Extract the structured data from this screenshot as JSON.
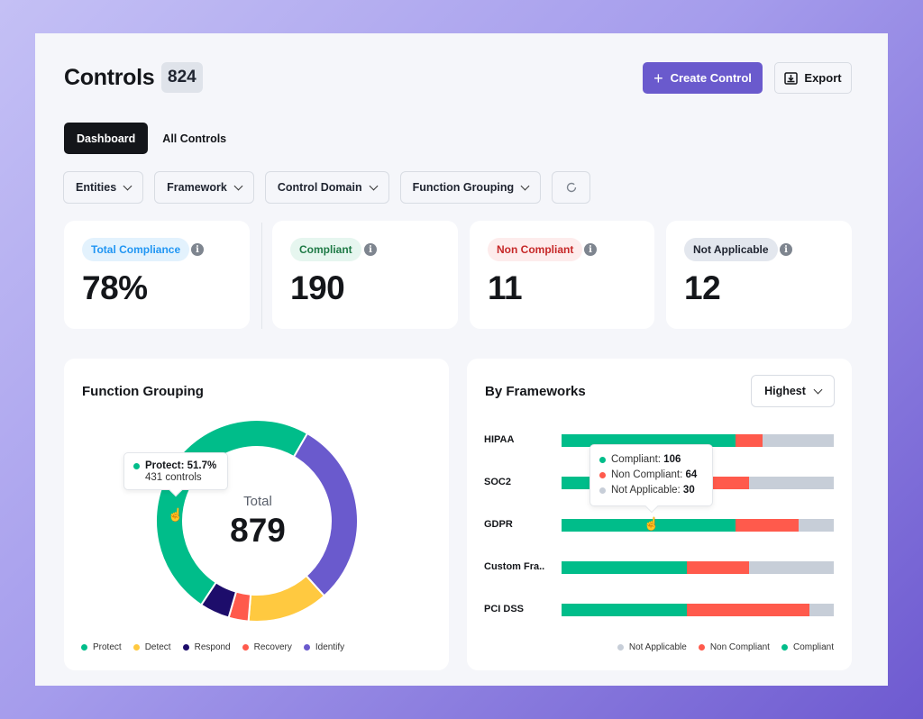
{
  "header": {
    "title": "Controls",
    "count": "824",
    "create_label": "Create Control",
    "export_label": "Export"
  },
  "tabs": [
    {
      "label": "Dashboard",
      "active": true
    },
    {
      "label": "All Controls",
      "active": false
    }
  ],
  "filters": [
    {
      "label": "Entities"
    },
    {
      "label": "Framework"
    },
    {
      "label": "Control Domain"
    },
    {
      "label": "Function Grouping"
    }
  ],
  "refresh_icon": "refresh-icon",
  "stats": [
    {
      "label": "Total Compliance",
      "value": "78%",
      "pill_bg": "#e3f2fd",
      "pill_fg": "#2196f3"
    },
    {
      "label": "Compliant",
      "value": "190",
      "pill_bg": "#e6f6ef",
      "pill_fg": "#1f7a46"
    },
    {
      "label": "Non Compliant",
      "value": "11",
      "pill_bg": "#fdecec",
      "pill_fg": "#c62828"
    },
    {
      "label": "Not Applicable",
      "value": "12",
      "pill_bg": "#e3e7ee",
      "pill_fg": "#1f2430"
    }
  ],
  "function_grouping": {
    "title": "Function Grouping",
    "center_label": "Total",
    "center_value": "879",
    "tooltip": {
      "title": "Protect: 51.7%",
      "sub": "431 controls",
      "color": "#00bd8a"
    }
  },
  "frameworks": {
    "title": "By Frameworks",
    "sort_label": "Highest",
    "tooltip": [
      {
        "label": "Compliant: ",
        "value": "106",
        "color": "#00bd8a"
      },
      {
        "label": "Non Compliant: ",
        "value": "64",
        "color": "#ff5a4c"
      },
      {
        "label": "Not Applicable: ",
        "value": "30",
        "color": "#c7ced8"
      }
    ]
  },
  "chart_data": [
    {
      "type": "pie",
      "title": "Function Grouping",
      "center_text": "Total 879",
      "categories": [
        "Protect",
        "Identify",
        "Detect",
        "Recovery",
        "Respond"
      ],
      "values": [
        431,
        264,
        114,
        28,
        42
      ],
      "colors": [
        "#00bd8a",
        "#6a5acd",
        "#ffc940",
        "#ff5a4c",
        "#1d0d6b"
      ],
      "legend": [
        "Protect",
        "Detect",
        "Respond",
        "Recovery",
        "Identify"
      ],
      "legend_colors": [
        "#00bd8a",
        "#ffc940",
        "#1d0d6b",
        "#ff5a4c",
        "#6a5acd"
      ],
      "legend_position": "bottom-left"
    },
    {
      "type": "bar",
      "orientation": "horizontal-stacked-percent",
      "title": "By Frameworks",
      "categories": [
        "HIPAA",
        "SOC2",
        "GDPR",
        "Custom Fra..",
        "PCI DSS"
      ],
      "series": [
        {
          "name": "Compliant",
          "color": "#00bd8a",
          "values": [
            64,
            46,
            64,
            46,
            46
          ]
        },
        {
          "name": "Non Compliant",
          "color": "#ff5a4c",
          "values": [
            10,
            23,
            23,
            23,
            45
          ]
        },
        {
          "name": "Not Applicable",
          "color": "#c7ced8",
          "values": [
            26,
            31,
            13,
            31,
            9
          ]
        }
      ],
      "legend": [
        "Not Applicable",
        "Non Compliant",
        "Compliant"
      ],
      "legend_position": "bottom-right",
      "xlim": [
        0,
        100
      ]
    }
  ]
}
